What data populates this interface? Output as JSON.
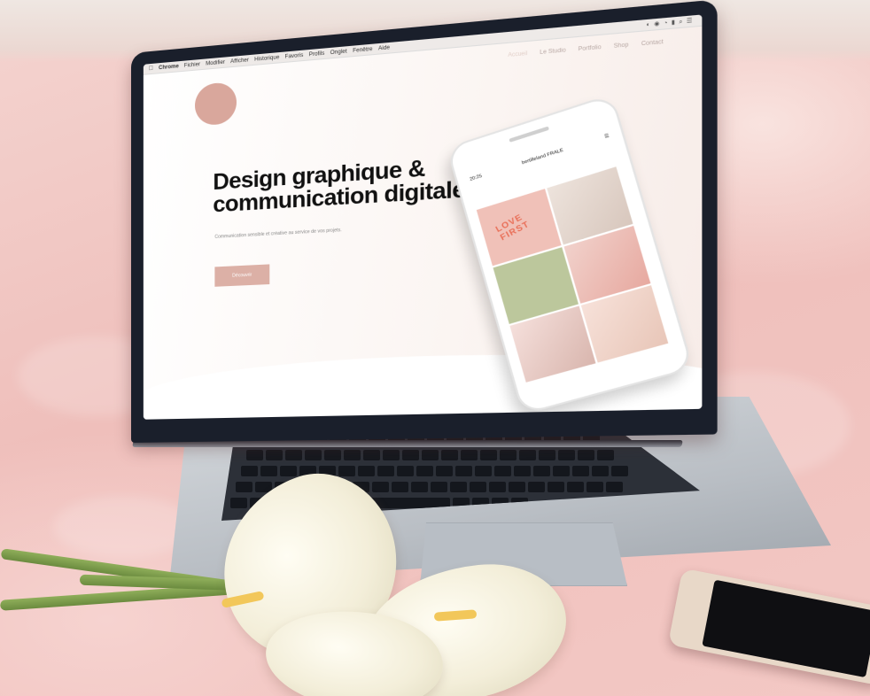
{
  "screen": {
    "menubar": {
      "app": "Chrome",
      "items": [
        "Fichier",
        "Modifier",
        "Afficher",
        "Historique",
        "Favoris",
        "Profils",
        "Onglet",
        "Fenêtre",
        "Aide"
      ]
    },
    "nav": [
      "Accueil",
      "Le Studio",
      "Portfolio",
      "Shop",
      "Contact"
    ],
    "hero": {
      "title_line1": "Design graphique &",
      "title_line2": "communication digitale",
      "subtitle": "Communication sensible et créative au service de vos projets.",
      "button": "Découvrir"
    },
    "phone": {
      "time": "20:25",
      "account": "bertilleland FRALE",
      "tile_text_line1": "LOVE",
      "tile_text_line2": "FIRST"
    }
  },
  "colors": {
    "bedding": "#f2c9c6",
    "accent": "#dcb0a6",
    "laptop_frame": "#1a1f2b"
  }
}
